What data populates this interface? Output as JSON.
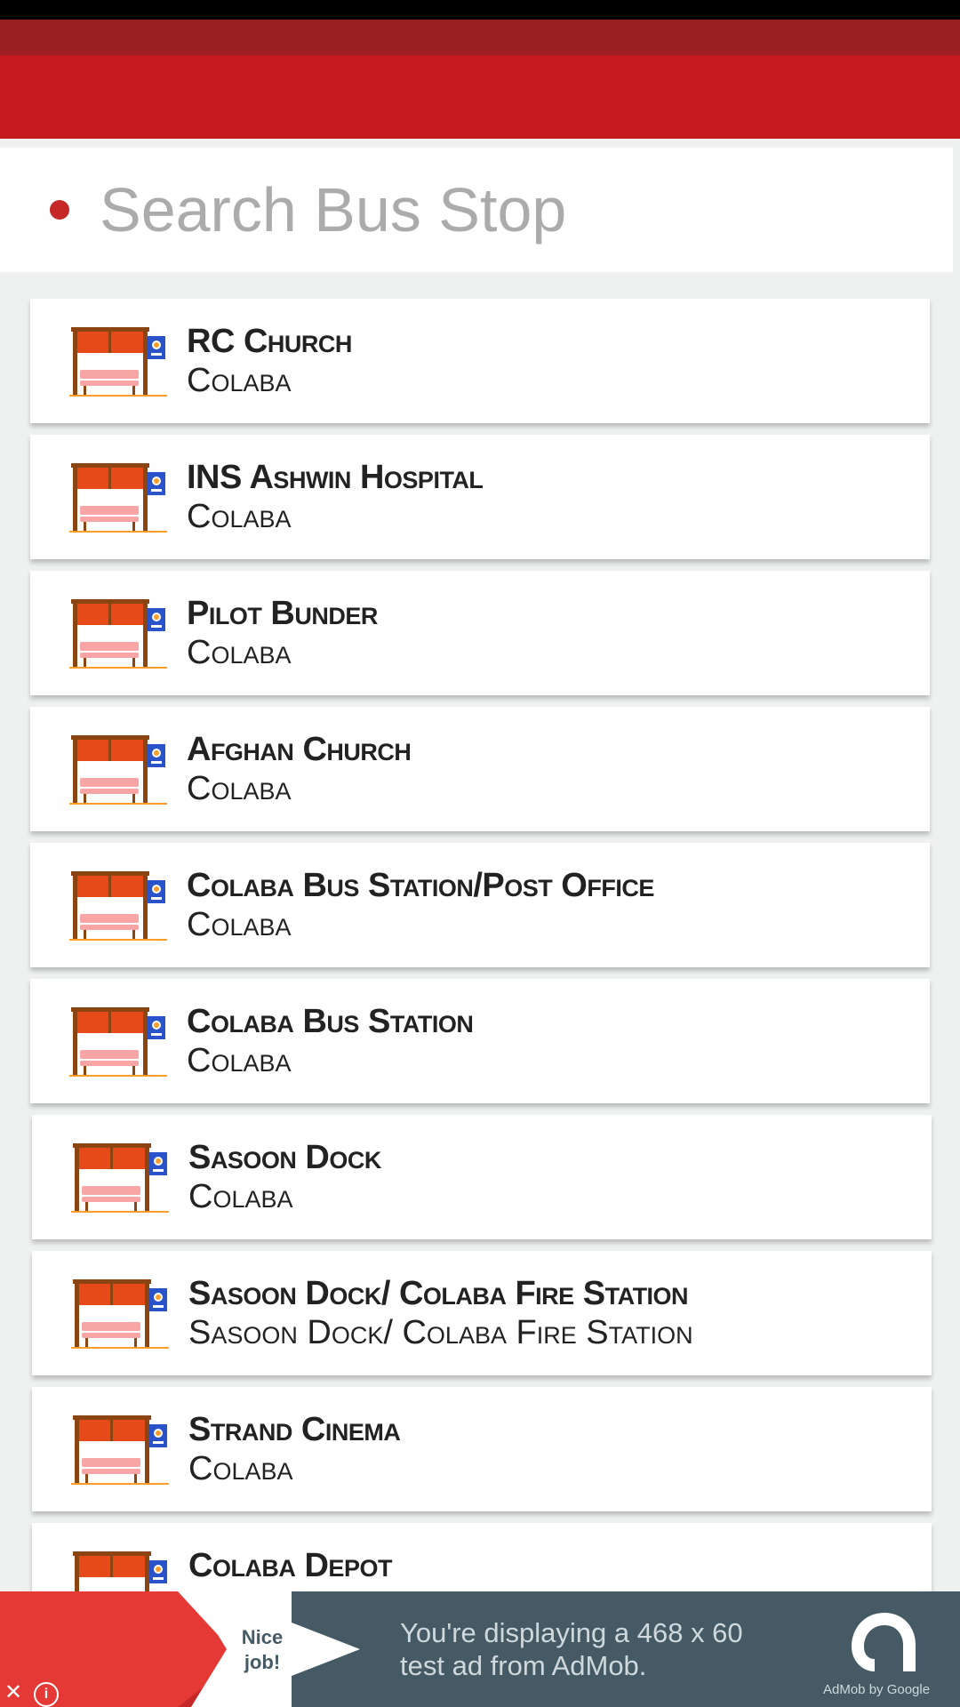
{
  "search": {
    "placeholder": "Search Bus Stop"
  },
  "stops": [
    {
      "name": "RC Church",
      "area": "Colaba"
    },
    {
      "name": "INS Ashwin Hospital",
      "area": "Colaba"
    },
    {
      "name": "Pilot Bunder",
      "area": "Colaba"
    },
    {
      "name": "Afghan Church",
      "area": "Colaba"
    },
    {
      "name": "Colaba Bus Station/Post Office",
      "area": "Colaba"
    },
    {
      "name": "Colaba Bus Station",
      "area": "Colaba"
    },
    {
      "name": "Sasoon Dock",
      "area": "Colaba"
    },
    {
      "name": "Sasoon Dock/ Colaba Fire Station",
      "area": "Sasoon Dock/ Colaba Fire Station"
    },
    {
      "name": "Strand Cinema",
      "area": "Colaba"
    },
    {
      "name": "Colaba Depot",
      "area": ""
    }
  ],
  "ad": {
    "badge_line1": "Nice",
    "badge_line2": "job!",
    "line1": "You're displaying a 468 x 60",
    "line2": "test ad from AdMob.",
    "brand": "AdMob by Google",
    "logo_icon": "admob-logo-icon",
    "close_icon": "close-icon",
    "info_icon": "info-icon"
  },
  "colors": {
    "app_bar": "#c3191f",
    "status_accent": "#9b1e22",
    "search_dot": "#c62828",
    "ad_background": "#455a64"
  }
}
